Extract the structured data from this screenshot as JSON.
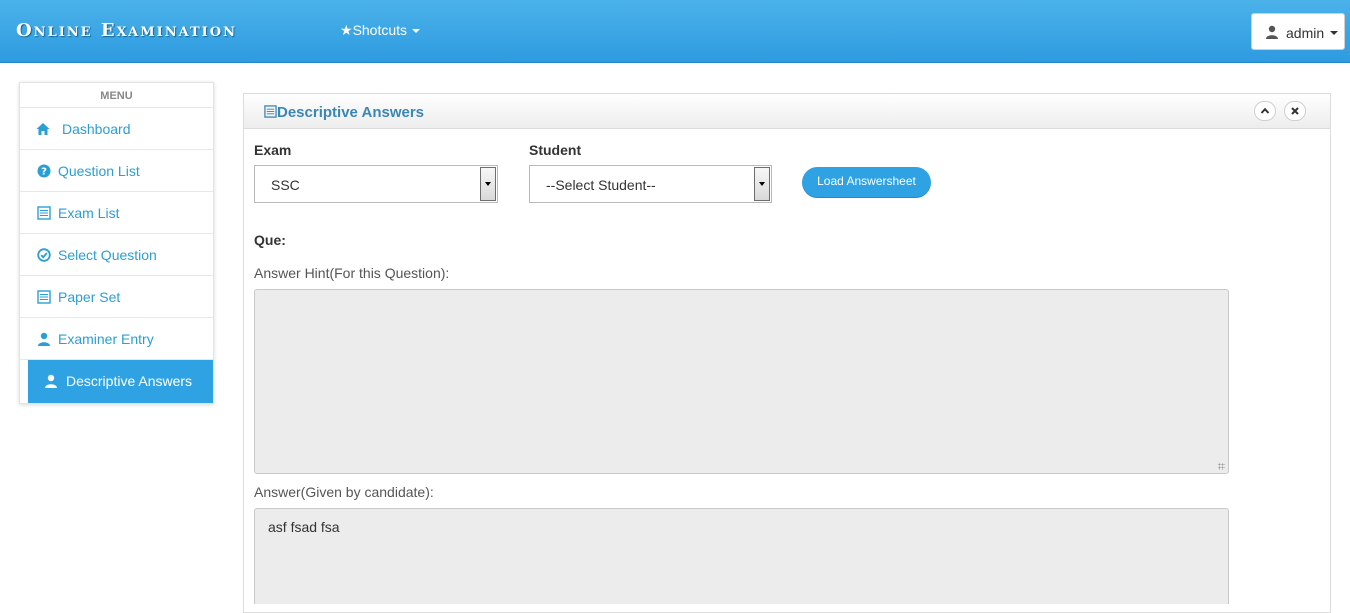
{
  "app": {
    "brand": "Online Examination"
  },
  "navbar": {
    "shortcuts_label": "Shotcuts",
    "user_label": "admin"
  },
  "sidebar": {
    "title": "MENU",
    "items": [
      {
        "label": "Dashboard",
        "icon": "home-icon"
      },
      {
        "label": "Question List",
        "icon": "question-circle-icon"
      },
      {
        "label": "Exam List",
        "icon": "list-icon"
      },
      {
        "label": "Select Question",
        "icon": "check-circle-icon"
      },
      {
        "label": "Paper Set",
        "icon": "list-icon"
      },
      {
        "label": "Examiner Entry",
        "icon": "user-icon"
      },
      {
        "label": "Descriptive Answers",
        "icon": "user-icon",
        "active": true
      }
    ]
  },
  "panel": {
    "title": "Descriptive Answers",
    "exam_label": "Exam",
    "exam_value": "SSC",
    "student_label": "Student",
    "student_value": "--Select Student--",
    "load_button": "Load Answersheet",
    "question_label": "Que:",
    "hint_label": "Answer Hint(For this Question):",
    "hint_value": "",
    "answer_label": "Answer(Given by candidate):",
    "answer_value": "asf fsad fsa"
  },
  "colors": {
    "primary": "#2ea2e3",
    "link": "#2a9fd6",
    "title": "#3a87b5"
  }
}
